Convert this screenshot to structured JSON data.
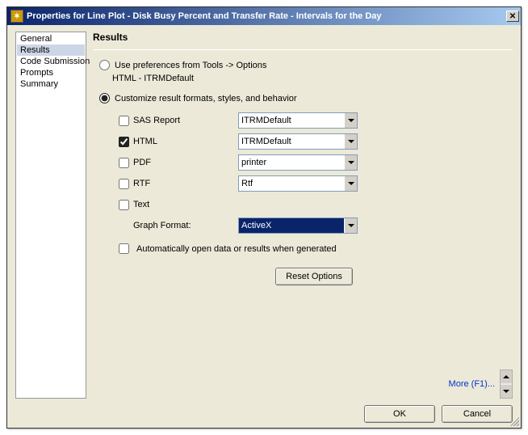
{
  "titlebar": {
    "title": "Properties for Line Plot - Disk Busy Percent and Transfer Rate - Intervals for the Day"
  },
  "sidebar": {
    "items": [
      {
        "label": "General",
        "selected": false
      },
      {
        "label": "Results",
        "selected": true
      },
      {
        "label": "Code Submission",
        "selected": false
      },
      {
        "label": "Prompts",
        "selected": false
      },
      {
        "label": "Summary",
        "selected": false
      }
    ]
  },
  "main": {
    "section_title": "Results",
    "radio_use_prefs": "Use preferences from Tools -> Options",
    "use_prefs_sub": "HTML - ITRMDefault",
    "radio_customize": "Customize result formats, styles, and behavior",
    "formats": {
      "sas_report": {
        "label": "SAS Report",
        "checked": false,
        "value": "ITRMDefault"
      },
      "html": {
        "label": "HTML",
        "checked": true,
        "value": "ITRMDefault"
      },
      "pdf": {
        "label": "PDF",
        "checked": false,
        "value": "printer"
      },
      "rtf": {
        "label": "RTF",
        "checked": false,
        "value": "Rtf"
      },
      "text": {
        "label": "Text",
        "checked": false
      }
    },
    "graph_format_label": "Graph Format:",
    "graph_format_value": "ActiveX",
    "auto_open_label": "Automatically open data or results when generated",
    "auto_open_checked": false,
    "reset_label": "Reset Options",
    "more_link": "More (F1)..."
  },
  "buttons": {
    "ok": "OK",
    "cancel": "Cancel"
  },
  "radio_selected": "customize"
}
